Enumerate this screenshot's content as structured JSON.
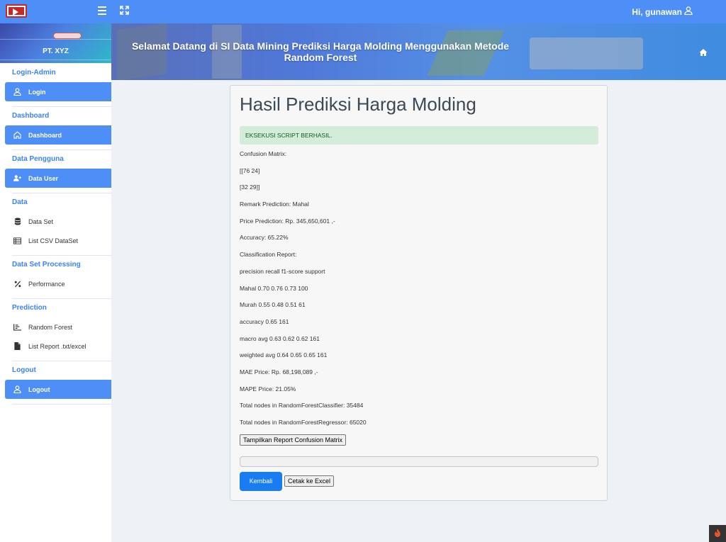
{
  "topbar": {
    "user_label": "Hi, gunawan"
  },
  "brand": {
    "name": "PT. XYZ"
  },
  "sidebar": {
    "sections": [
      {
        "heading": "Login-Admin",
        "items": [
          {
            "label": "Login",
            "icon": "user-icon",
            "active": true
          }
        ]
      },
      {
        "heading": "Dashboard",
        "items": [
          {
            "label": "Dashboard",
            "icon": "home-icon",
            "active": true
          }
        ]
      },
      {
        "heading": "Data Pengguna",
        "items": [
          {
            "label": "Data User",
            "icon": "user-plus-icon",
            "active": true
          }
        ]
      },
      {
        "heading": "Data",
        "items": [
          {
            "label": "Data Set",
            "icon": "database-icon",
            "active": false
          },
          {
            "label": "List CSV DataSet",
            "icon": "table-icon",
            "active": false
          }
        ]
      },
      {
        "heading": "Data Set Processing",
        "items": [
          {
            "label": "Performance",
            "icon": "percent-icon",
            "active": false
          }
        ]
      },
      {
        "heading": "Prediction",
        "items": [
          {
            "label": "Random Forest",
            "icon": "chart-icon",
            "active": false
          },
          {
            "label": "List Report .txt/excel",
            "icon": "file-icon",
            "active": false
          }
        ]
      },
      {
        "heading": "Logout",
        "items": [
          {
            "label": "Logout",
            "icon": "user-icon",
            "active": true
          }
        ]
      }
    ]
  },
  "banner": {
    "title_line1": "Selamat Datang di SI Data Mining Prediksi Harga Molding Menggunakan Metode",
    "title_line2": "Random Forest"
  },
  "result": {
    "title": "Hasil Prediksi Harga Molding",
    "alert": "EKSEKUSI SCRIPT BERHASIL.",
    "lines": [
      "Confusion Matrix:",
      "[[76 24]",
      "[32 29]]",
      "Remark Prediction: Mahal",
      "Price Prediction: Rp. 345,650,601 ,-",
      "Accuracy: 65.22%",
      "Classification Report:",
      "precision recall f1-score support",
      "Mahal 0.70 0.76 0.73 100",
      "Murah 0.55 0.48 0.51 61",
      "accuracy 0.65 161",
      "macro avg 0.63 0.62 0.62 161",
      "weighted avg 0.64 0.65 0.65 161",
      "MAE Price: Rp. 68,198,089 ,-",
      "MAPE Price: 21.05%",
      "Total nodes in RandomForestClassifier: 35484",
      "Total nodes in RandomForestRegressor: 65020"
    ],
    "show_report_button": "Tampilkan Report Confusion Matrix",
    "back_button": "Kembali",
    "export_button": "Cetak ke Excel"
  }
}
